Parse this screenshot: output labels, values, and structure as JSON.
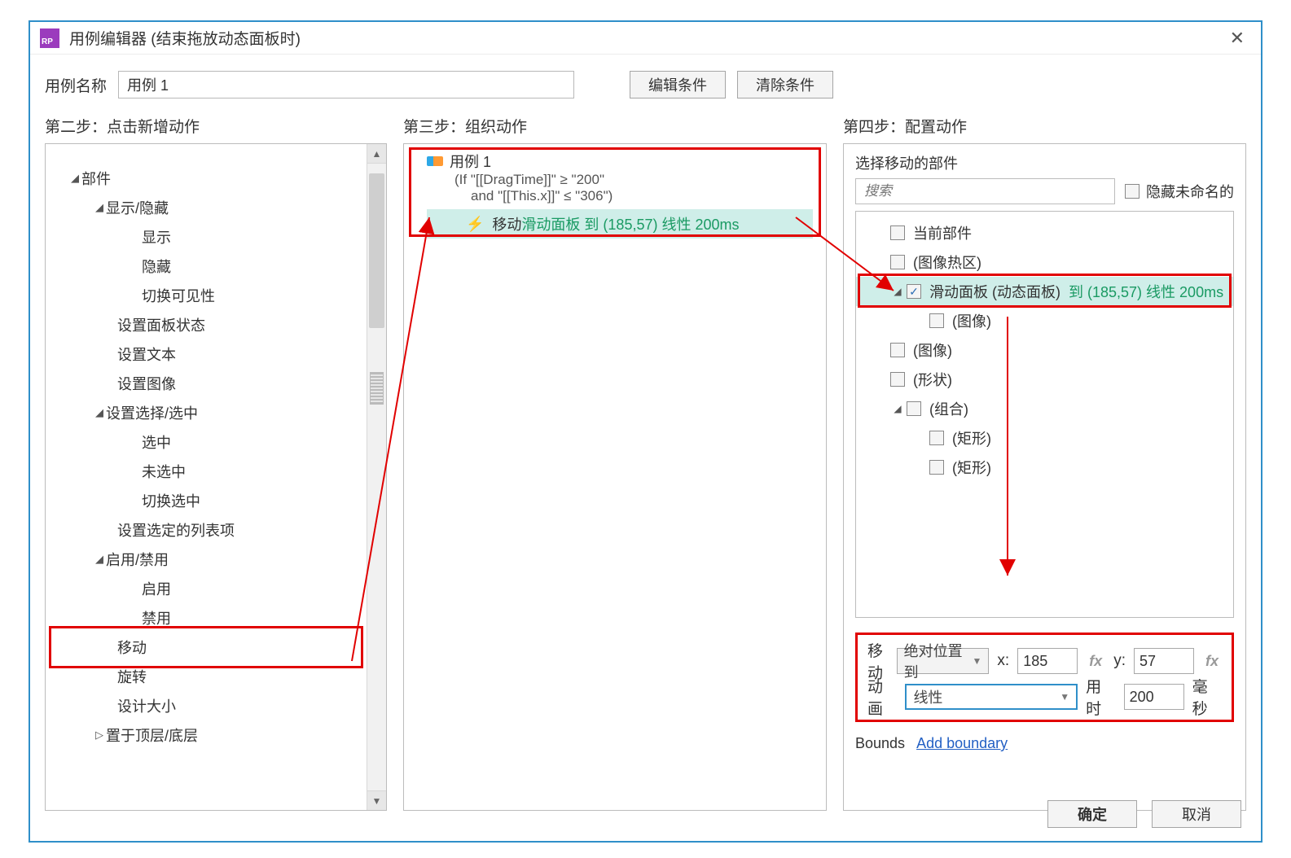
{
  "title": "用例编辑器 (结束拖放动态面板时)",
  "caseNameLabel": "用例名称",
  "caseName": "用例 1",
  "buttons": {
    "editCond": "编辑条件",
    "clearCond": "清除条件",
    "ok": "确定",
    "cancel": "取消"
  },
  "steps": {
    "s2": "第二步：点击新增动作",
    "s3": "第三步：组织动作",
    "s4": "第四步：配置动作"
  },
  "step2": {
    "truncatedTop": "设置面板状态…",
    "items": [
      {
        "label": "部件",
        "indent": 1,
        "caret": true
      },
      {
        "label": "显示/隐藏",
        "indent": 2,
        "caret": true
      },
      {
        "label": "显示",
        "indent": 4
      },
      {
        "label": "隐藏",
        "indent": 4
      },
      {
        "label": "切换可见性",
        "indent": 4
      },
      {
        "label": "设置面板状态",
        "indent": 3
      },
      {
        "label": "设置文本",
        "indent": 3
      },
      {
        "label": "设置图像",
        "indent": 3
      },
      {
        "label": "设置选择/选中",
        "indent": 2,
        "caret": true
      },
      {
        "label": "选中",
        "indent": 4
      },
      {
        "label": "未选中",
        "indent": 4
      },
      {
        "label": "切换选中",
        "indent": 4
      },
      {
        "label": "设置选定的列表项",
        "indent": 3
      },
      {
        "label": "启用/禁用",
        "indent": 2,
        "caret": true
      },
      {
        "label": "启用",
        "indent": 4
      },
      {
        "label": "禁用",
        "indent": 4
      },
      {
        "label": "移动",
        "indent": 3,
        "highlight": true
      },
      {
        "label": "旋转",
        "indent": 3
      },
      {
        "label": "设计大小",
        "indent": 3
      },
      {
        "label": "置于顶层/底层",
        "indent": 2,
        "caretHollow": true
      }
    ]
  },
  "step3": {
    "caseTitle": "用例 1",
    "condLines": [
      "(If \"[[DragTime]]\" ≥ \"200\"",
      "    and \"[[This.x]]\" ≤ \"306\")"
    ],
    "actionPrefix": "移动 ",
    "actionGreen": "滑动面板 到 (185,57) 线性 200ms"
  },
  "step4": {
    "header": "选择移动的部件",
    "searchPlaceholder": "搜索",
    "hideUnnamed": "隐藏未命名的",
    "widgets": [
      {
        "indent": 1,
        "chk": false,
        "label": "当前部件"
      },
      {
        "indent": 1,
        "chk": false,
        "label": "(图像热区)"
      },
      {
        "indent": 2,
        "chk": true,
        "label": "滑动面板 (动态面板)",
        "green": "到 (185,57) 线性 200ms",
        "caret": true,
        "selected": true
      },
      {
        "indent": 3,
        "chk": false,
        "label": "(图像)"
      },
      {
        "indent": 1,
        "chk": false,
        "label": "(图像)"
      },
      {
        "indent": 1,
        "chk": false,
        "label": "(形状)"
      },
      {
        "indent": 2,
        "chk": false,
        "label": "(组合)",
        "caret": true
      },
      {
        "indent": 3,
        "chk": false,
        "label": "(矩形)"
      },
      {
        "indent": 3,
        "chk": false,
        "label": "(矩形)"
      }
    ],
    "config": {
      "moveLabel": "移动",
      "moveType": "绝对位置到",
      "xLabel": "x:",
      "xVal": "185",
      "yLabel": "y:",
      "yVal": "57",
      "animLabel": "动画",
      "animType": "线性",
      "durLabel": "用时",
      "durVal": "200",
      "durUnit": "毫秒",
      "boundsLabel": "Bounds",
      "addBoundary": "Add boundary"
    }
  }
}
